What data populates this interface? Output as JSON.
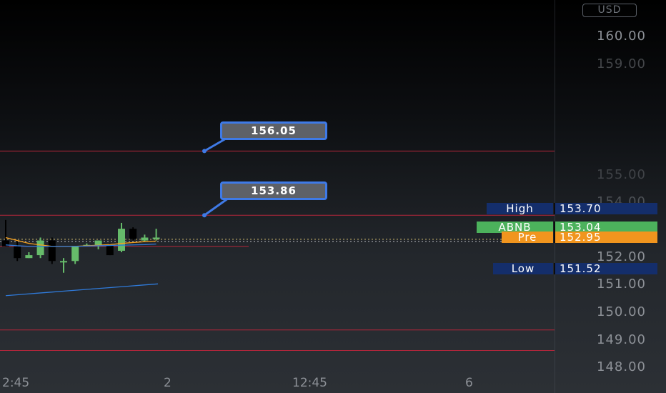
{
  "currency": "USD",
  "price_axis": {
    "labels": [
      "160.00",
      "159.00",
      "155.00",
      "154.00",
      "152.00",
      "151.00",
      "150.00",
      "149.00",
      "148.00"
    ]
  },
  "time_axis": {
    "labels": [
      "2:45",
      "2",
      "12:45",
      "6"
    ]
  },
  "price_tags": {
    "high": {
      "name": "High",
      "value": "153.70",
      "color": "#142e6b"
    },
    "symbol": {
      "name": "ABNB",
      "value": "153.04",
      "color": "#4cb25c"
    },
    "pre": {
      "name": "Pre",
      "value": "152.95",
      "color": "#f1951e"
    },
    "low": {
      "name": "Low",
      "value": "151.52",
      "color": "#142e6b"
    }
  },
  "callouts": [
    {
      "label": "156.05"
    },
    {
      "label": "153.86"
    }
  ],
  "colors": {
    "up": "#66bb6a",
    "down": "#000000",
    "ma_orange": "#f5a020",
    "ma_blue": "#2f7ad9",
    "level_line": "#b3263b",
    "callout_border": "#3f7ae6"
  },
  "chart_data": {
    "type": "candlestick",
    "y_range": [
      147.8,
      161.2
    ],
    "horizontal_levels": [
      156.05,
      153.86,
      149.95,
      149.25
    ],
    "last_price": 153.04,
    "candles": [
      {
        "open": 153.0,
        "high": 153.7,
        "low": 152.8,
        "close": 152.8
      },
      {
        "open": 152.8,
        "high": 153.0,
        "low": 152.3,
        "close": 152.4
      },
      {
        "open": 152.4,
        "high": 152.6,
        "low": 152.4,
        "close": 152.5
      },
      {
        "open": 152.5,
        "high": 153.1,
        "low": 152.4,
        "close": 153.0
      },
      {
        "open": 153.0,
        "high": 153.1,
        "low": 152.2,
        "close": 152.3
      },
      {
        "open": 152.3,
        "high": 152.4,
        "low": 151.9,
        "close": 152.3
      },
      {
        "open": 152.3,
        "high": 152.8,
        "low": 152.2,
        "close": 152.8
      },
      {
        "open": 152.8,
        "high": 152.9,
        "low": 152.8,
        "close": 152.85
      },
      {
        "open": 152.85,
        "high": 153.0,
        "low": 152.7,
        "close": 153.0
      },
      {
        "open": 152.85,
        "high": 152.9,
        "low": 152.5,
        "close": 152.5
      },
      {
        "open": 152.65,
        "high": 153.6,
        "low": 152.6,
        "close": 153.4
      },
      {
        "open": 153.4,
        "high": 153.45,
        "low": 153.0,
        "close": 153.05
      },
      {
        "open": 153.0,
        "high": 153.2,
        "low": 152.95,
        "close": 153.1
      },
      {
        "open": 153.05,
        "high": 153.4,
        "low": 153.0,
        "close": 153.1
      }
    ],
    "ma_orange": [
      153.1,
      153.0,
      152.9,
      152.85,
      152.8,
      152.8,
      152.8,
      152.82,
      152.84,
      152.86,
      152.9,
      152.93,
      152.96,
      152.98
    ],
    "ma_blue_upper": [
      152.85,
      152.82,
      152.8,
      152.8,
      152.8,
      152.8,
      152.8,
      152.81,
      152.82,
      152.83,
      152.84,
      152.85,
      152.86,
      152.88
    ],
    "ma_blue_lower": [
      151.12,
      151.16,
      151.2,
      151.24,
      151.28,
      151.32,
      151.36,
      151.4,
      151.44,
      151.48,
      151.52
    ]
  }
}
